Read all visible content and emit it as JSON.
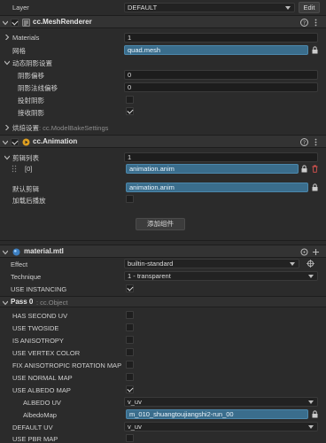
{
  "layer": {
    "label": "Layer",
    "value": "DEFAULT",
    "edit_label": "Edit"
  },
  "mesh_renderer": {
    "title": "cc.MeshRenderer",
    "materials_label": "Materials",
    "materials_value": "1",
    "mesh_label": "网格",
    "mesh_value": "quad.mesh",
    "shadow_group": "动态阴影设置",
    "shadow_bias_label": "阴影偏移",
    "shadow_bias_value": "0",
    "shadow_normal_bias_label": "阴影法线偏移",
    "shadow_normal_bias_value": "0",
    "cast_shadow_label": "投射阴影",
    "receive_shadow_label": "接收阴影",
    "bake_label": "烘焙设置",
    "bake_type": ": cc.ModelBakeSettings"
  },
  "animation": {
    "title": "cc.Animation",
    "clips_label": "剪辑列表",
    "clips_value": "1",
    "clip0_label": "[0]",
    "clip0_value": "animation.anim",
    "default_clip_label": "默认剪辑",
    "default_clip_value": "animation.anim",
    "play_on_load_label": "加载后播放",
    "add_component_label": "添加组件"
  },
  "material": {
    "title": "material.mtl",
    "effect_label": "Effect",
    "effect_value": "builtin-standard",
    "technique_label": "Technique",
    "technique_value": "1 - transparent",
    "use_instancing_label": "USE INSTANCING",
    "pass_label": "Pass 0",
    "pass_type": ": cc.Object",
    "props": [
      {
        "label": "HAS SECOND UV",
        "checked": false
      },
      {
        "label": "USE TWOSIDE",
        "checked": false
      },
      {
        "label": "IS ANISOTROPY",
        "checked": false
      },
      {
        "label": "USE VERTEX COLOR",
        "checked": false
      },
      {
        "label": "FIX ANISOTROPIC ROTATION MAP",
        "checked": false
      },
      {
        "label": "USE NORMAL MAP",
        "checked": false
      },
      {
        "label": "USE ALBEDO MAP",
        "checked": true
      }
    ],
    "albedo_uv_label": "ALBEDO UV",
    "albedo_uv_value": "v_uv",
    "albedo_map_label": "AlbedoMap",
    "albedo_map_value": "m_010_shuangtoujiangshi2-run_00",
    "default_uv_label": "DEFAULT UV",
    "default_uv_value": "v_uv",
    "use_pbr_map_label": "USE PBR MAP"
  }
}
